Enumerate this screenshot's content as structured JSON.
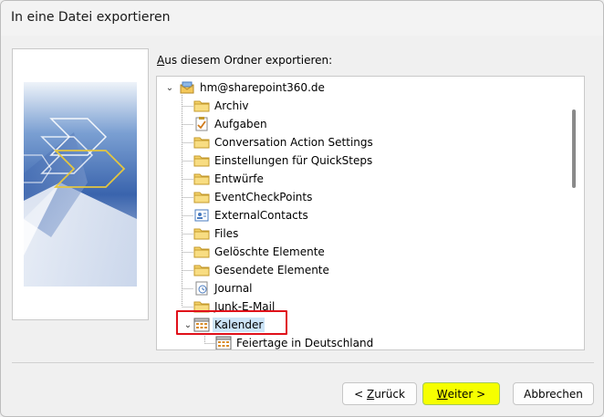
{
  "window": {
    "title": "In eine Datei exportieren"
  },
  "folder_section": {
    "label_prefix": "A",
    "label_rest": "us diesem Ordner exportieren:"
  },
  "tree": {
    "items": [
      {
        "label": "hm@sharepoint360.de",
        "icon": "mailbox-icon",
        "expanded": true
      },
      {
        "label": "Archiv",
        "icon": "folder-icon"
      },
      {
        "label": "Aufgaben",
        "icon": "tasks-icon"
      },
      {
        "label": "Conversation Action Settings",
        "icon": "folder-icon"
      },
      {
        "label": "Einstellungen für QuickSteps",
        "icon": "folder-icon"
      },
      {
        "label": "Entwürfe",
        "icon": "folder-icon"
      },
      {
        "label": "EventCheckPoints",
        "icon": "folder-icon"
      },
      {
        "label": "ExternalContacts",
        "icon": "contacts-icon"
      },
      {
        "label": "Files",
        "icon": "folder-icon"
      },
      {
        "label": "Gelöschte Elemente",
        "icon": "folder-icon"
      },
      {
        "label": "Gesendete Elemente",
        "icon": "folder-icon"
      },
      {
        "label": "Journal",
        "icon": "journal-icon"
      },
      {
        "label": "Junk-E-Mail",
        "icon": "folder-icon"
      },
      {
        "label": "Kalender",
        "icon": "calendar-icon",
        "expanded": true,
        "selected": true
      },
      {
        "label": "Feiertage in Deutschland",
        "icon": "calendar-icon"
      }
    ]
  },
  "buttons": {
    "back_prefix": "< ",
    "back_ul": "Z",
    "back_rest": "urück",
    "next_ul": "W",
    "next_rest": "eiter >",
    "cancel": "Abbrechen"
  },
  "colors": {
    "selection": "#cce4f7",
    "highlight_border": "#e0101a",
    "next_button": "#f6ff00"
  }
}
